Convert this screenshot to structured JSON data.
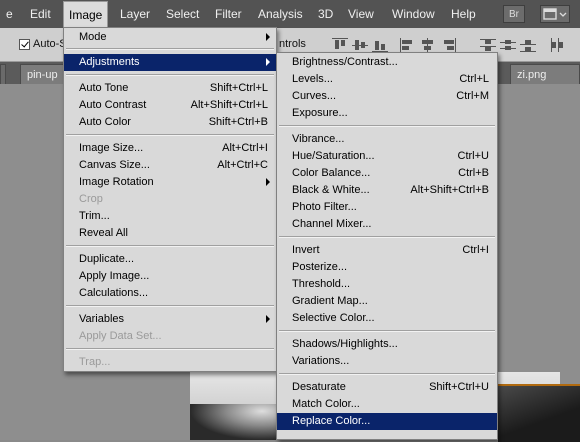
{
  "menubar": {
    "items": [
      "e",
      "Edit",
      "Image",
      "Layer",
      "Select",
      "Filter",
      "Analysis",
      "3D",
      "View",
      "Window",
      "Help"
    ],
    "br_label": "Br"
  },
  "options": {
    "auto_select": "Auto-S",
    "transform_controls": "ntrols"
  },
  "tabs": {
    "left": "pin-up",
    "right": "zi.png"
  },
  "image_menu": {
    "mode": "Mode",
    "adjustments": "Adjustments",
    "auto_tone": "Auto Tone",
    "auto_tone_sc": "Shift+Ctrl+L",
    "auto_contrast": "Auto Contrast",
    "auto_contrast_sc": "Alt+Shift+Ctrl+L",
    "auto_color": "Auto Color",
    "auto_color_sc": "Shift+Ctrl+B",
    "image_size": "Image Size...",
    "image_size_sc": "Alt+Ctrl+I",
    "canvas_size": "Canvas Size...",
    "canvas_size_sc": "Alt+Ctrl+C",
    "image_rotation": "Image Rotation",
    "crop": "Crop",
    "trim": "Trim...",
    "reveal_all": "Reveal All",
    "duplicate": "Duplicate...",
    "apply_image": "Apply Image...",
    "calculations": "Calculations...",
    "variables": "Variables",
    "apply_data_set": "Apply Data Set...",
    "trap": "Trap..."
  },
  "adjust_menu": {
    "brightness_contrast": "Brightness/Contrast...",
    "levels": "Levels...",
    "levels_sc": "Ctrl+L",
    "curves": "Curves...",
    "curves_sc": "Ctrl+M",
    "exposure": "Exposure...",
    "vibrance": "Vibrance...",
    "hue_saturation": "Hue/Saturation...",
    "hue_saturation_sc": "Ctrl+U",
    "color_balance": "Color Balance...",
    "color_balance_sc": "Ctrl+B",
    "black_white": "Black & White...",
    "black_white_sc": "Alt+Shift+Ctrl+B",
    "photo_filter": "Photo Filter...",
    "channel_mixer": "Channel Mixer...",
    "invert": "Invert",
    "invert_sc": "Ctrl+I",
    "posterize": "Posterize...",
    "threshold": "Threshold...",
    "gradient_map": "Gradient Map...",
    "selective_color": "Selective Color...",
    "shadows_highlights": "Shadows/Highlights...",
    "variations": "Variations...",
    "desaturate": "Desaturate",
    "desaturate_sc": "Shift+Ctrl+U",
    "match_color": "Match Color...",
    "replace_color": "Replace Color..."
  },
  "colors": {
    "highlight": "#0a246a",
    "menu_bg": "#d9d9d9",
    "menubar_bg": "#535353"
  }
}
